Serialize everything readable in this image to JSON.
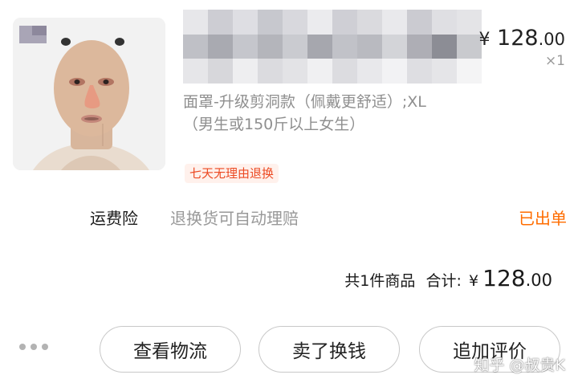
{
  "product": {
    "icon": "product-mask-image",
    "price_currency": "¥",
    "price_int": "128",
    "price_cents": ".00",
    "quantity": "×1",
    "spec": "面罩-升级剪洞款（佩戴更舒适）;XL（男生或150斤以上女生）",
    "tag": "七天无理由退换"
  },
  "insurance": {
    "label": "运费险",
    "desc": "退换货可自动理赔",
    "status": "已出单"
  },
  "summary": {
    "count_text": "共1件商品",
    "total_label": "合计:",
    "currency": "¥",
    "amount_int": "128",
    "amount_cents": ".00"
  },
  "actions": {
    "more_icon": "more-dots-icon",
    "logistics": "查看物流",
    "resell": "卖了换钱",
    "review": "追加评价"
  },
  "watermark": "知乎 @叔贵K",
  "colors": {
    "accent": "#ff6d00",
    "tag_text": "#ec4a23",
    "tag_bg": "#fff1ec"
  }
}
